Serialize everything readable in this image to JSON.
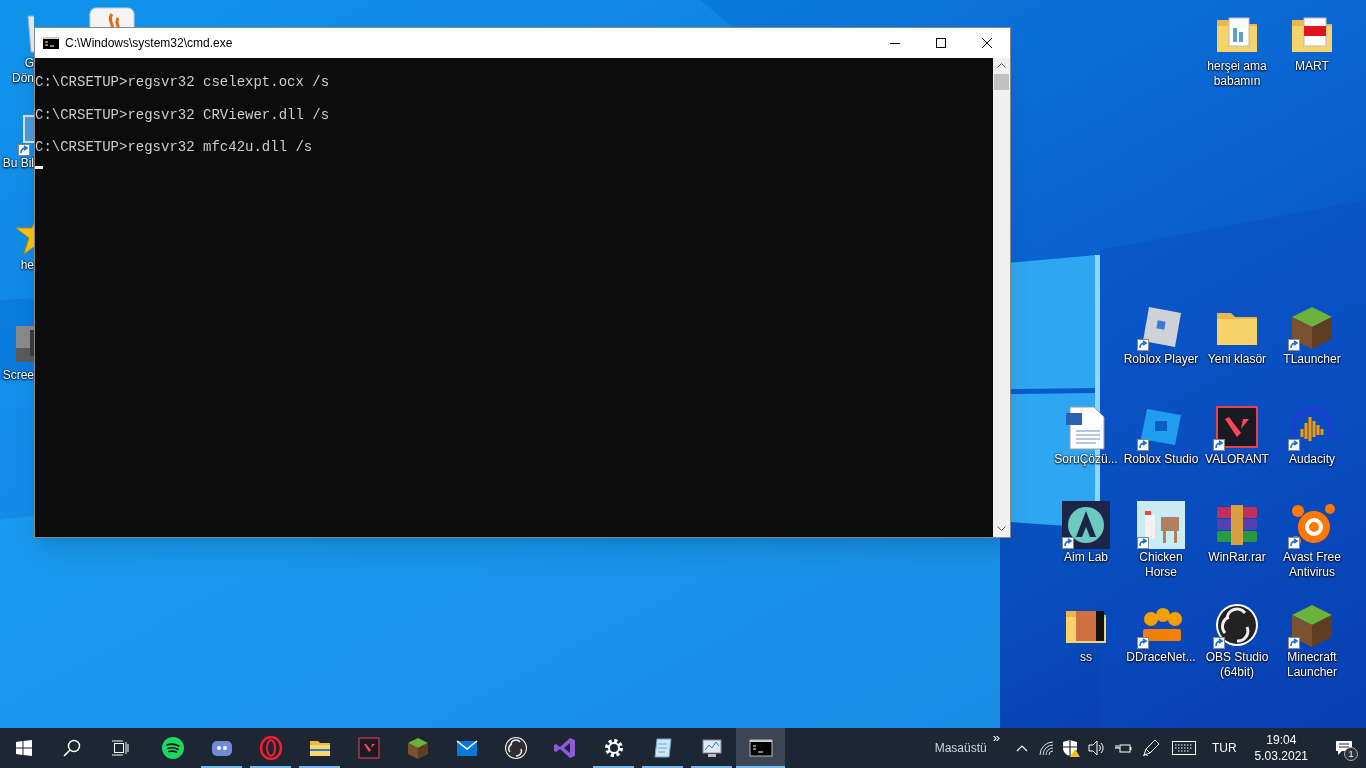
{
  "desktop": {
    "icons": [
      {
        "label": "G\nDön",
        "shortcut": false
      },
      {
        "shortcut": false
      },
      {
        "label": "Bu Bil",
        "shortcut": true
      },
      {
        "label": "he",
        "shortcut": false
      },
      {
        "label": "Scree",
        "shortcut": false
      },
      {
        "label": "herşei ama babamın",
        "shortcut": false
      },
      {
        "label": "MART",
        "shortcut": false
      },
      {
        "label": "Roblox Player",
        "shortcut": true
      },
      {
        "label": "Yeni klasör",
        "shortcut": false
      },
      {
        "label": "TLauncher",
        "shortcut": true
      },
      {
        "label": "SoruÇözü...",
        "shortcut": false
      },
      {
        "label": "Roblox Studio",
        "shortcut": true
      },
      {
        "label": "VALORANT",
        "shortcut": true
      },
      {
        "label": "Audacity",
        "shortcut": true
      },
      {
        "label": "Aim Lab",
        "shortcut": true
      },
      {
        "label": "Chicken Horse",
        "shortcut": true
      },
      {
        "label": "WinRar.rar",
        "shortcut": false
      },
      {
        "label": "Avast Free Antivirus",
        "shortcut": true
      },
      {
        "label": "ss",
        "shortcut": false
      },
      {
        "label": "DDraceNet...",
        "shortcut": true
      },
      {
        "label": "OBS Studio (64bit)",
        "shortcut": true
      },
      {
        "label": "Minecraft Launcher",
        "shortcut": true
      }
    ]
  },
  "window": {
    "title": "C:\\Windows\\system32\\cmd.exe",
    "lines": [
      "C:\\CRSETUP>regsvr32 cselexpt.ocx /s",
      "C:\\CRSETUP>regsvr32 CRViewer.dll /s",
      "C:\\CRSETUP>regsvr32 mfc42u.dll /s"
    ]
  },
  "taskbar": {
    "apps": [
      {
        "running": false,
        "selected": false
      },
      {
        "running": true,
        "selected": false
      },
      {
        "running": true,
        "selected": false
      },
      {
        "running": true,
        "selected": false
      },
      {
        "running": false,
        "selected": false
      },
      {
        "running": false,
        "selected": false
      },
      {
        "running": false,
        "selected": false
      },
      {
        "running": false,
        "selected": false
      },
      {
        "running": false,
        "selected": false
      },
      {
        "running": true,
        "selected": false
      },
      {
        "running": true,
        "selected": false
      },
      {
        "running": true,
        "selected": false
      },
      {
        "running": true,
        "selected": true
      }
    ],
    "toolbar_label": "Masaüstü",
    "toolbar_more": "»",
    "language": "TUR",
    "time": "19:04",
    "date": "5.03.2021",
    "notification_count": "1"
  }
}
